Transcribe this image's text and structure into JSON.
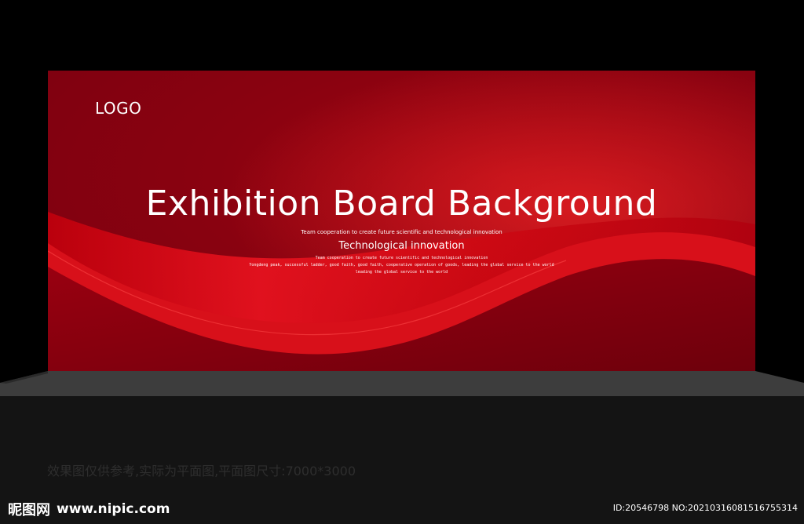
{
  "board": {
    "logo": "LOGO",
    "title": "Exhibition Board Background",
    "subtitle_small": "Team cooperation to create future scientific and technological innovation",
    "subtitle": "Technological innovation",
    "lines": [
      "Team cooperation to create future scientific and technological innovation",
      "Yongdeng peak, successful ladder, good faith, good faith, cooperative operation of goods, leading the global service to the world",
      "leading the global service to the world"
    ]
  },
  "caption": "效果图仅供参考,实际为平面图,平面图尺寸:7000*3000",
  "watermark": {
    "brand_cn": "昵图网",
    "brand_url": "www.nipic.com",
    "id_text": "ID:20546798 NO:20210316081516755314"
  },
  "colors": {
    "background": "#000000",
    "board_red": "#8a0210",
    "wave_bright": "#e8101c",
    "floor": "#141414",
    "floor_edge": "#3a3a3a"
  }
}
